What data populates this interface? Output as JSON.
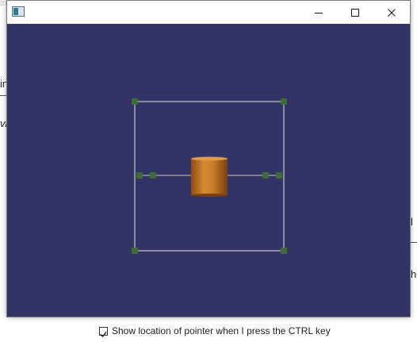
{
  "window": {
    "title": "",
    "controls": {
      "minimize_icon": "minimize-icon",
      "maximize_icon": "maximize-icon",
      "close_icon": "close-icon"
    }
  },
  "viewport": {
    "background_color": "#333366",
    "scene": {
      "object": "cylinder",
      "object_color": "#c07a2c",
      "bounding_box_color": "#c8c8c8",
      "handle_color": "#3f6b3a"
    }
  },
  "background_app": {
    "checkbox_label": "Show location of pointer when I press the CTRL key",
    "fragments": [
      "in",
      "vi",
      "l",
      "he"
    ]
  }
}
